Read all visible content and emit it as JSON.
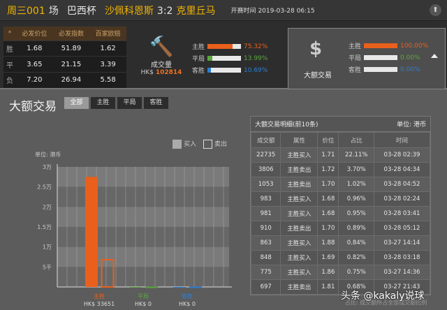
{
  "header": {
    "match_no": "周三001",
    "field": "场",
    "league": "巴西杯",
    "home": "沙佩科恩斯",
    "score": "3:2",
    "away": "克里丘马",
    "time_label": "开赛时间",
    "time": "2019-03-28 06:15"
  },
  "odds": {
    "headers": [
      "*",
      "必发价位",
      "必发指数",
      "百家欧赔"
    ],
    "rows": [
      [
        "胜",
        "1.68",
        "51.89",
        "1.62"
      ],
      [
        "平",
        "3.65",
        "21.15",
        "3.39"
      ],
      [
        "负",
        "7.20",
        "26.94",
        "5.58"
      ]
    ]
  },
  "volume": {
    "label": "成交量",
    "currency": "HK$",
    "amount": "102814",
    "rows": [
      {
        "name": "主胜",
        "pct": "75.32%",
        "value": 75.32,
        "color": "#e8601c"
      },
      {
        "name": "平局",
        "pct": "13.99%",
        "value": 13.99,
        "color": "#5aa83c"
      },
      {
        "name": "客胜",
        "pct": "10.69%",
        "value": 10.69,
        "color": "#2a7fd4"
      }
    ]
  },
  "big_trade": {
    "label": "大额交易",
    "rows": [
      {
        "name": "主胜",
        "pct": "100.00%",
        "value": 100,
        "color": "#e8601c"
      },
      {
        "name": "平局",
        "pct": "0.00%",
        "value": 0,
        "color": "#5aa83c"
      },
      {
        "name": "客胜",
        "pct": "0.00%",
        "value": 0,
        "color": "#2a7fd4"
      }
    ]
  },
  "section": {
    "title": "大额交易",
    "tabs": [
      "全部",
      "主胜",
      "平局",
      "客胜"
    ]
  },
  "chart_data": {
    "type": "bar",
    "unit": "单位: 港币",
    "legend": [
      "买入",
      "卖出"
    ],
    "yticks": [
      "3万",
      "2.5万",
      "2万",
      "1.5万",
      "1万",
      "5千"
    ],
    "ylim": [
      0,
      30000
    ],
    "categories": [
      {
        "name": "主胜",
        "total": "HK$ 33651",
        "color": "#e8601c",
        "buy": 27500,
        "sell": 6800
      },
      {
        "name": "平局",
        "total": "HK$ 0",
        "color": "#5aa83c",
        "buy": 0,
        "sell": 0
      },
      {
        "name": "客胜",
        "total": "HK$ 0",
        "color": "#2a7fd4",
        "buy": 0,
        "sell": 0
      }
    ]
  },
  "table": {
    "title": "大额交易明细(前10条)",
    "unit": "单位: 港币",
    "columns": [
      "成交额",
      "属性",
      "价位",
      "占比",
      "时间"
    ],
    "rows": [
      [
        "22735",
        "主胜买入",
        "1.71",
        "22.11%",
        "03-28 02:39"
      ],
      [
        "3806",
        "主胜卖出",
        "1.72",
        "3.70%",
        "03-28 04:34"
      ],
      [
        "1053",
        "主胜卖出",
        "1.70",
        "1.02%",
        "03-28 04:52"
      ],
      [
        "983",
        "主胜买入",
        "1.68",
        "0.96%",
        "03-28 02:24"
      ],
      [
        "981",
        "主胜买入",
        "1.68",
        "0.95%",
        "03-28 03:41"
      ],
      [
        "910",
        "主胜卖出",
        "1.70",
        "0.89%",
        "03-28 05:12"
      ],
      [
        "863",
        "主胜买入",
        "1.88",
        "0.84%",
        "03-27 14:14"
      ],
      [
        "848",
        "主胜买入",
        "1.69",
        "0.82%",
        "03-28 03:18"
      ],
      [
        "775",
        "主胜买入",
        "1.86",
        "0.75%",
        "03-27 14:36"
      ],
      [
        "697",
        "主胜卖出",
        "1.81",
        "0.68%",
        "03-27 21:43"
      ]
    ],
    "note": "占比: 成交额所占全部成交额比例"
  },
  "watermark": "头条 @kakaly说球"
}
